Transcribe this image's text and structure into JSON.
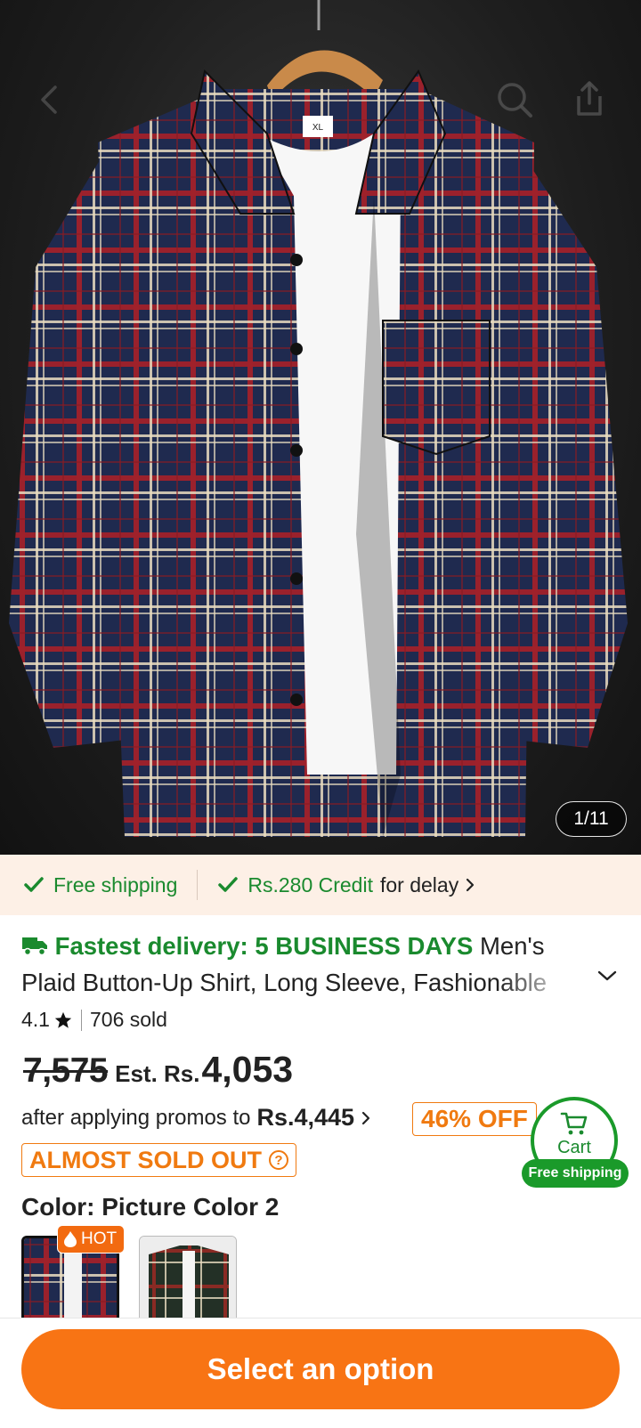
{
  "hero": {
    "image_counter": "1/11",
    "icons": [
      "back-chevron-icon",
      "search-icon",
      "share-icon"
    ],
    "size_tag": "XL"
  },
  "shipping_banner": {
    "item1": "Free shipping",
    "item2_highlight": "Rs.280 Credit",
    "item2_rest": "for delay"
  },
  "product": {
    "fastest_delivery": "Fastest delivery: 5 BUSINESS DAYS",
    "title": "Men's Plaid Button-Up Shirt, Long Sleeve, Fashionable and",
    "rating": "4.1",
    "sold": "706 sold",
    "original_price": "7,575",
    "est_label": "Est. Rs.",
    "est_price": "4,053",
    "promo_text": "after applying promos to",
    "promo_price": "Rs.4,445",
    "discount_badge": "46% OFF",
    "stock_badge": "ALMOST SOLD OUT",
    "color_label": "Color: Picture Color 2",
    "hot_badge": "HOT"
  },
  "cart": {
    "label": "Cart",
    "pill": "Free shipping"
  },
  "bottom": {
    "cta": "Select an option"
  },
  "colors": {
    "accent_orange": "#f87414",
    "success_green": "#1a8a2e",
    "banner_bg": "#fdf0e6"
  }
}
